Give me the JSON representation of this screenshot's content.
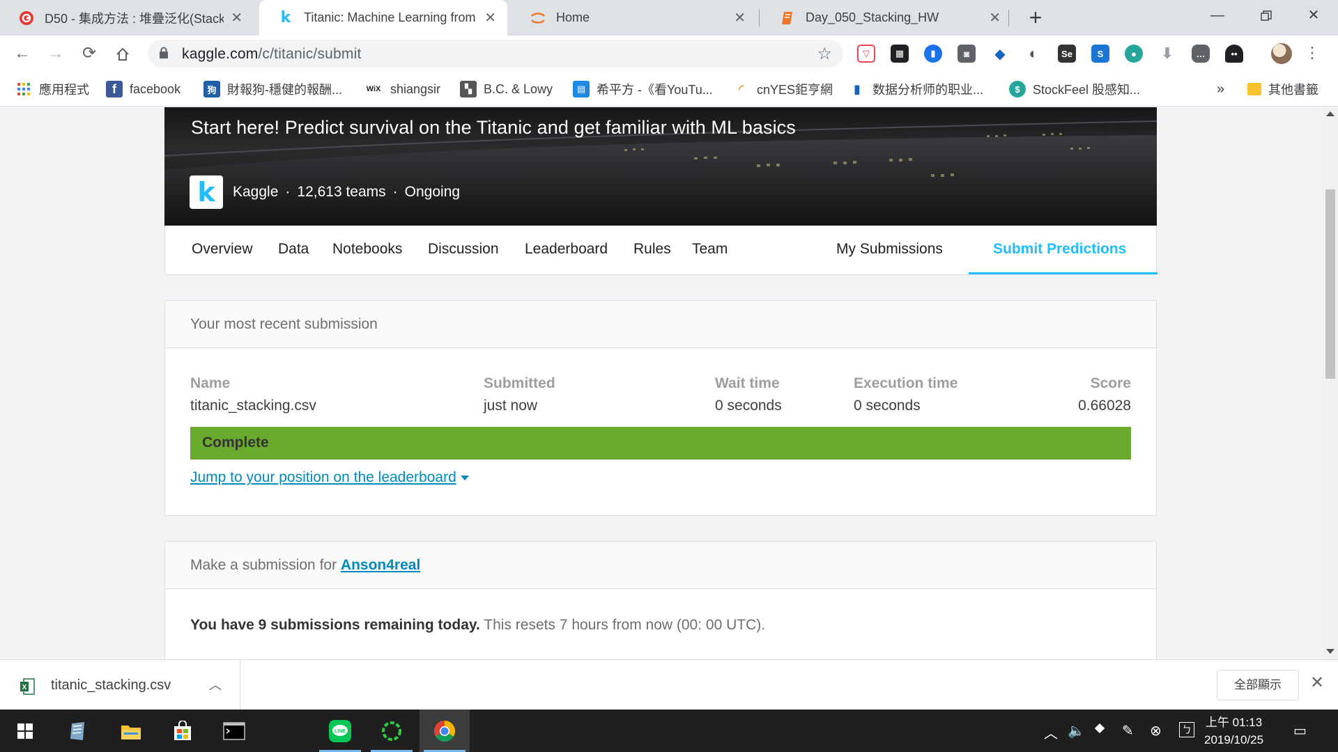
{
  "browser": {
    "tabs": [
      {
        "title": "D50 - 集成方法 : 堆疊泛化(Stack",
        "active": false
      },
      {
        "title": "Titanic: Machine Learning from",
        "active": true
      },
      {
        "title": "Home",
        "active": false
      },
      {
        "title": "Day_050_Stacking_HW",
        "active": false
      }
    ],
    "new_tab_label": "+",
    "url_host": "kaggle.com",
    "url_path": "/c/titanic/submit",
    "bookmarks": [
      {
        "label": "應用程式"
      },
      {
        "label": "facebook"
      },
      {
        "label": "財報狗-穩健的報酬..."
      },
      {
        "label": "shiangsir"
      },
      {
        "label": "B.C. & Lowy"
      },
      {
        "label": "希平方 -《看YouTu..."
      },
      {
        "label": "cnYES鉅亨網"
      },
      {
        "label": "数据分析师的职业..."
      },
      {
        "label": "StockFeel 股感知..."
      }
    ],
    "bookmarks_overflow": "»",
    "other_bookmarks": "其他書籤"
  },
  "hero": {
    "tagline": "Start here! Predict survival on the Titanic and get familiar with ML basics",
    "logo_letter": "k",
    "host": "Kaggle",
    "teams": "12,613 teams",
    "status": "Ongoing",
    "separator": "·"
  },
  "comp_nav": {
    "items": [
      "Overview",
      "Data",
      "Notebooks",
      "Discussion",
      "Leaderboard",
      "Rules",
      "Team"
    ],
    "my_submissions": "My Submissions",
    "submit_predictions": "Submit Predictions"
  },
  "recent_submission": {
    "title": "Your most recent submission",
    "columns": {
      "name": {
        "label": "Name",
        "value": "titanic_stacking.csv"
      },
      "submitted": {
        "label": "Submitted",
        "value": "just now"
      },
      "wait": {
        "label": "Wait time",
        "value": "0 seconds"
      },
      "execution": {
        "label": "Execution time",
        "value": "0 seconds"
      },
      "score": {
        "label": "Score",
        "value": "0.66028"
      }
    },
    "status": "Complete",
    "jump_link": "Jump to your position on the leaderboard"
  },
  "make_submission": {
    "title_prefix": "Make a submission for ",
    "username": "Anson4real",
    "remaining_bold": "You have 9 submissions remaining today.",
    "remaining_rest": " This resets 7 hours from now (00: 00 UTC)."
  },
  "download_shelf": {
    "filename": "titanic_stacking.csv",
    "show_all": "全部顯示"
  },
  "taskbar": {
    "time": "上午 01:13",
    "date": "2019/10/25"
  },
  "colors": {
    "kaggle_blue": "#20beff",
    "complete_green": "#6aaa2e",
    "link_blue": "#008abc"
  }
}
